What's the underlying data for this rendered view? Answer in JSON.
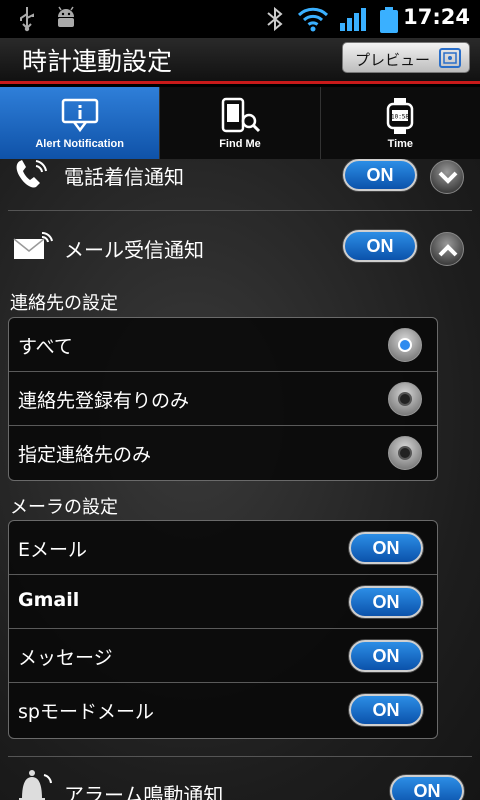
{
  "status_bar": {
    "time": "17:24",
    "icons": [
      "usb-icon",
      "android-debug-icon",
      "bluetooth-icon",
      "wifi-icon",
      "signal-icon",
      "battery-icon"
    ]
  },
  "titlebar": {
    "title": "時計連動設定",
    "preview_label": "プレビュー"
  },
  "tabs": [
    {
      "label": "Alert Notification",
      "icon": "alert-notification-icon",
      "active": true
    },
    {
      "label": "Find Me",
      "icon": "find-me-icon",
      "active": false
    },
    {
      "label": "Time",
      "icon": "watch-icon",
      "active": false
    }
  ],
  "call_notify": {
    "label": "電話着信通知",
    "toggle": "ON",
    "icon": "phone-icon"
  },
  "mail_notify": {
    "label": "メール受信通知",
    "toggle": "ON",
    "icon": "mail-icon"
  },
  "contacts_section": {
    "title": "連絡先の設定",
    "options": [
      {
        "label": "すべて",
        "selected": true
      },
      {
        "label": "連絡先登録有りのみ",
        "selected": false
      },
      {
        "label": "指定連絡先のみ",
        "selected": false
      }
    ]
  },
  "mailer_section": {
    "title": "メーラの設定",
    "items": [
      {
        "label": "Eメール",
        "toggle": "ON"
      },
      {
        "label": "Gmail",
        "toggle": "ON"
      },
      {
        "label": "メッセージ",
        "toggle": "ON"
      },
      {
        "label": "spモードメール",
        "toggle": "ON"
      }
    ]
  },
  "alarm_notify": {
    "label": "アラーム鳴動通知",
    "toggle": "ON",
    "icon": "bell-icon"
  },
  "colors": {
    "accent": "#1a6bd0",
    "title_rule": "#c81a1a"
  }
}
